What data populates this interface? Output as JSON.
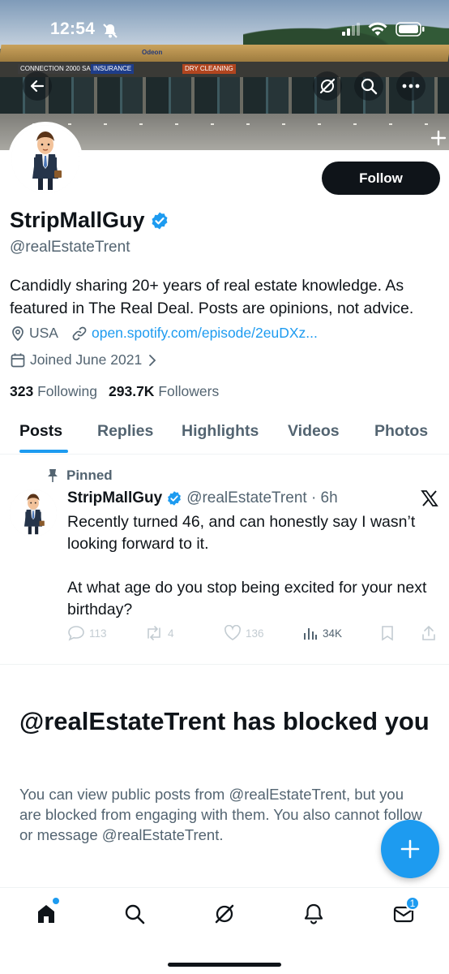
{
  "status_bar": {
    "time": "12:54"
  },
  "banner": {
    "signs": [
      "CONNECTION 2000 SALON",
      "INSURANCE",
      "Odeon",
      "DRY CLEANING"
    ]
  },
  "profile": {
    "name": "StripMallGuy",
    "handle": "@realEstateTrent",
    "follow_label": "Follow",
    "bio": "Candidly sharing 20+ years of real estate knowledge. As featured in The Real Deal. Posts are opinions, not advice.",
    "location": "USA",
    "link": "open.spotify.com/episode/2euDXz...",
    "joined": "Joined June 2021",
    "following_count": "323",
    "following_label": "Following",
    "followers_count": "293.7K",
    "followers_label": "Followers"
  },
  "tabs": [
    {
      "label": "Posts",
      "active": true
    },
    {
      "label": "Replies"
    },
    {
      "label": "Highlights"
    },
    {
      "label": "Videos"
    },
    {
      "label": "Photos"
    }
  ],
  "pinned_post": {
    "pinned_label": "Pinned",
    "author": "StripMallGuy",
    "handle_time": "@realEstateTrent · 6h",
    "text": "Recently turned 46, and can honestly say I wasn’t looking forward to it.\n\nAt what age do you stop being excited for your next birthday?",
    "replies": "113",
    "reposts": "4",
    "likes": "136",
    "views": "34K"
  },
  "blocked": {
    "title": "@realEstateTrent has blocked you",
    "description": "You can view public posts from @realEstateTrent, but you are blocked from engaging with them. You also cannot follow or message @realEstateTrent."
  },
  "nav": {
    "messages_badge": "1"
  },
  "colors": {
    "accent": "#1d9bf0",
    "text": "#0f1419",
    "muted": "#536471"
  }
}
